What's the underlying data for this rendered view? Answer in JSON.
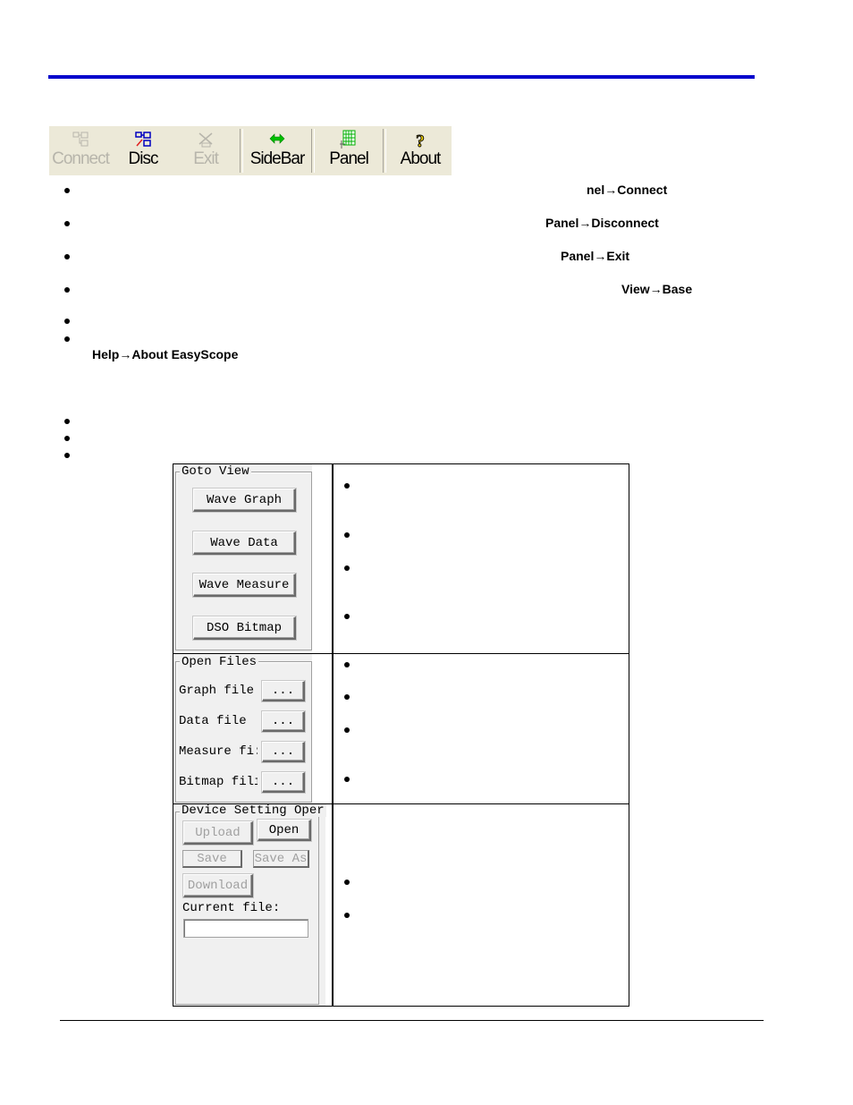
{
  "page": {
    "accent_color": "#0000cc"
  },
  "toolbar": {
    "buttons": [
      {
        "label": "Connect",
        "icon": "connect-icon",
        "enabled": false
      },
      {
        "label": "Disc",
        "icon": "disconnect-icon",
        "enabled": true
      },
      {
        "label": "Exit",
        "icon": "exit-icon",
        "enabled": false
      },
      {
        "label": "SideBar",
        "icon": "sidebar-arrows-icon",
        "enabled": true
      },
      {
        "label": "Panel",
        "icon": "panel-grid-icon",
        "enabled": true
      },
      {
        "label": "About",
        "icon": "help-question-icon",
        "enabled": true
      }
    ]
  },
  "toolbar_bullets": [
    {
      "menu_ref": "nel→Connect"
    },
    {
      "menu_ref": "Panel→Disconnect"
    },
    {
      "menu_ref": "Panel→Exit"
    },
    {
      "menu_ref": "View→Base"
    },
    {
      "menu_ref": ""
    },
    {
      "menu_ref": "Help→About EasyScope"
    }
  ],
  "sidebar": {
    "goto_view": {
      "title": "Goto View",
      "buttons": [
        "Wave Graph",
        "Wave Data",
        "Wave Measure",
        "DSO Bitmap"
      ]
    },
    "open_files": {
      "title": "Open Files",
      "rows": [
        {
          "label": "Graph file",
          "button": "..."
        },
        {
          "label": "Data file",
          "button": "..."
        },
        {
          "label": "Measure fi:",
          "button": "..."
        },
        {
          "label": "Bitmap filı",
          "button": "..."
        }
      ]
    },
    "device_setting": {
      "title": "Device Setting Oper",
      "upload": "Upload",
      "open": "Open",
      "save": "Save",
      "save_as": "Save As",
      "download": "Download",
      "current_file_label": "Current file:",
      "current_file_value": ""
    }
  }
}
